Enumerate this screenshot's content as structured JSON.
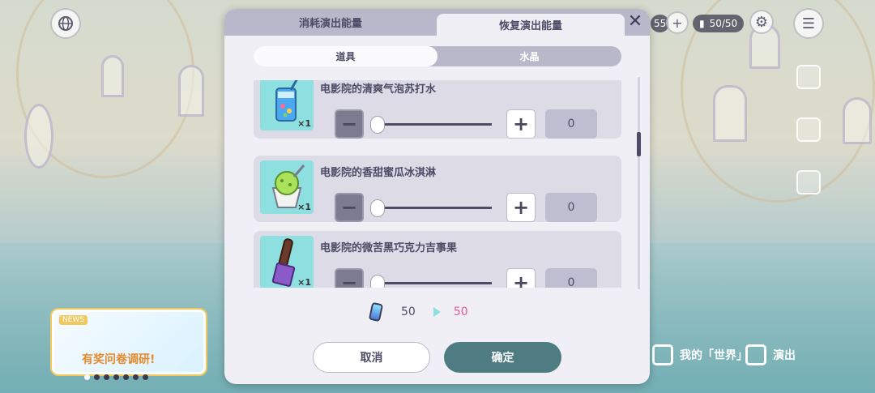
{
  "hud": {
    "crystal_count": "50/50",
    "currency_fragment": "55"
  },
  "modal": {
    "tabs": [
      {
        "label": "消耗演出能量",
        "active": false
      },
      {
        "label": "恢复演出能量",
        "active": true
      }
    ],
    "close_icon": "close-icon",
    "sub_tabs": [
      {
        "label": "道具",
        "active": true
      },
      {
        "label": "水晶",
        "active": false
      }
    ],
    "items": [
      {
        "name": "电影院的清爽气泡苏打水",
        "qty": "×1",
        "value": "0",
        "icon": "soda-icon"
      },
      {
        "name": "电影院的香甜蜜瓜冰淇淋",
        "qty": "×1",
        "value": "0",
        "icon": "icecream-icon"
      },
      {
        "name": "电影院的微苦黑巧克力吉事果",
        "qty": "×1",
        "value": "0",
        "icon": "churro-icon"
      }
    ],
    "energy": {
      "icon": "energy-drink-icon",
      "from": "50",
      "to": "50"
    },
    "cancel_label": "取消",
    "confirm_label": "确定"
  },
  "background": {
    "event_banner_headline": "有奖问卷调研!",
    "bottom_nav": [
      {
        "label": "我的「世界」"
      },
      {
        "label": "演出"
      }
    ]
  },
  "colors": {
    "accent": "#4f7c82",
    "highlight": "#e2589a",
    "panel": "#efeff5",
    "tab_inactive": "#b9b8cb"
  }
}
